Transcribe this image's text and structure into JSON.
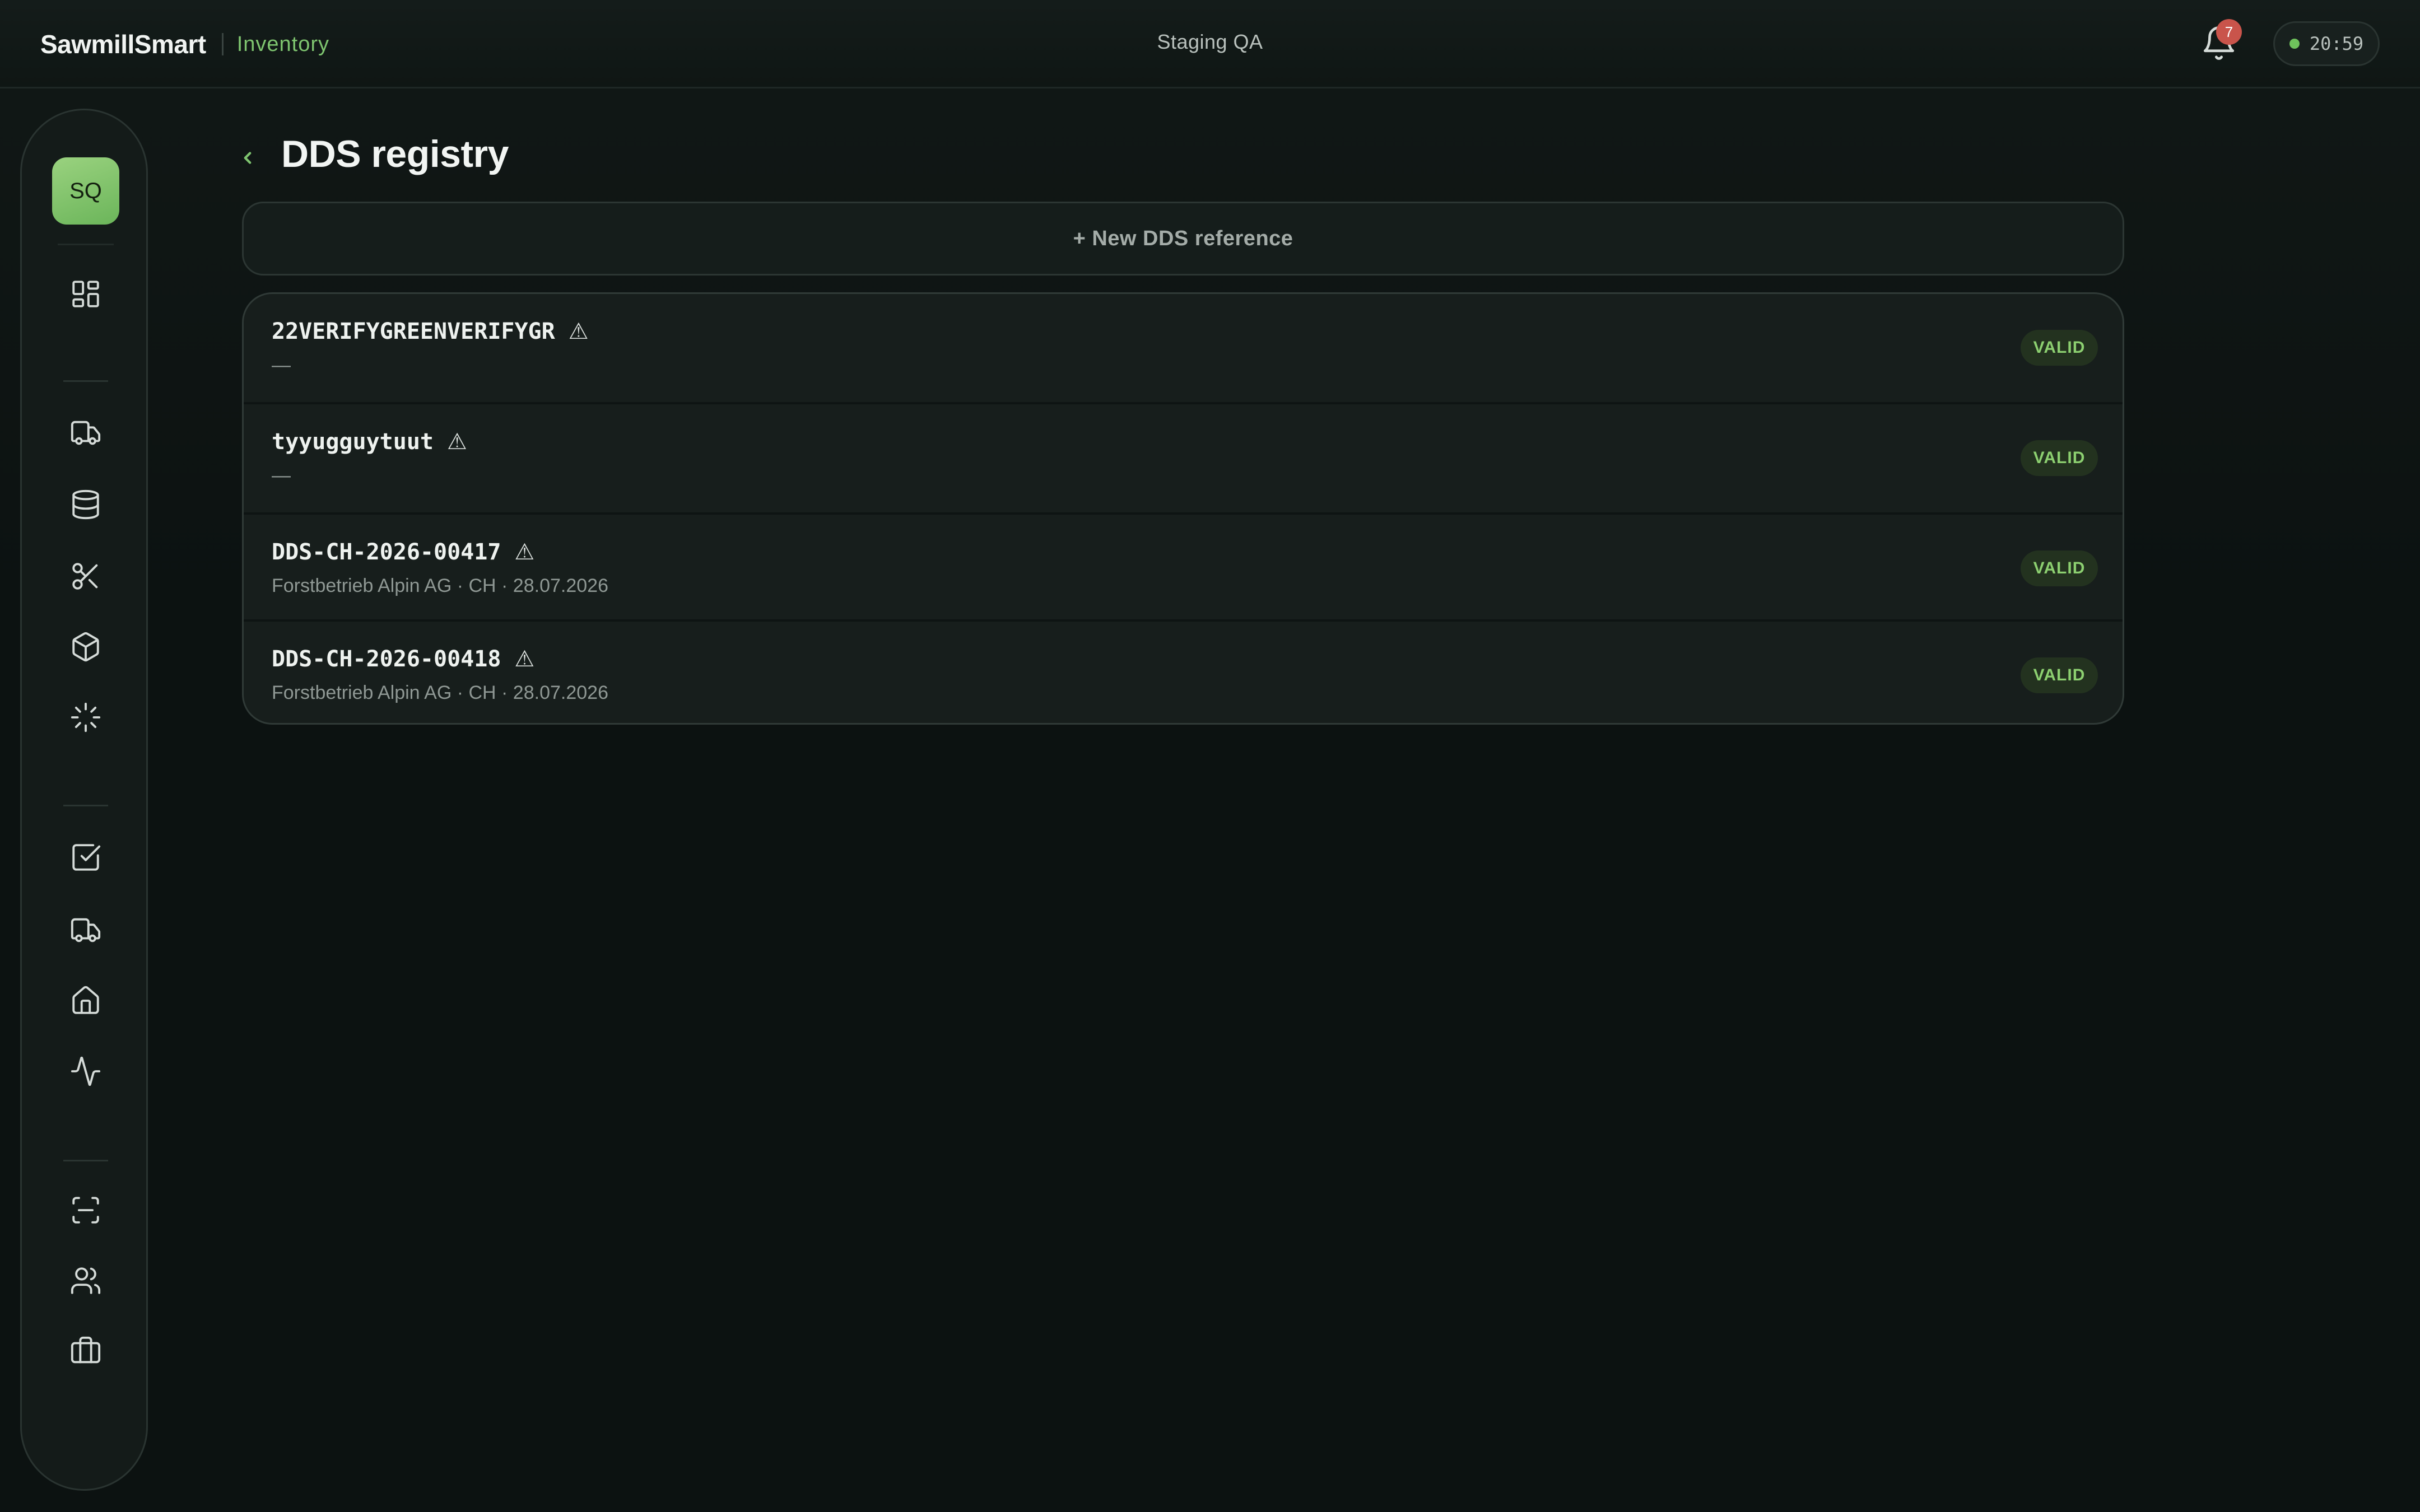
{
  "header": {
    "brand": "SawmillSmart",
    "module": "Inventory",
    "environment": "Staging QA",
    "notifications_count": "7",
    "clock": "20:59",
    "status_color": "#6fc25c"
  },
  "sidebar": {
    "avatar_initials": "SQ",
    "icons": [
      "dashboard-icon",
      "truck-icon",
      "database-icon",
      "scissors-icon",
      "box-icon",
      "loader-icon",
      "checkbox-icon",
      "delivery-truck-icon",
      "home-icon",
      "activity-icon",
      "scan-icon",
      "users-icon",
      "briefcase-icon"
    ]
  },
  "page": {
    "title": "DDS registry",
    "new_button": "+ New DDS reference"
  },
  "registry": [
    {
      "code": "22VERIFYGREENVERIFYGR",
      "warning": "⚠",
      "subtitle": "—",
      "status": "VALID"
    },
    {
      "code": "tyyugguytuut",
      "warning": "⚠",
      "subtitle": "—",
      "status": "VALID"
    },
    {
      "code": "DDS-CH-2026-00417",
      "warning": "⚠",
      "subtitle": "Forstbetrieb Alpin AG · CH · 28.07.2026",
      "status": "VALID"
    },
    {
      "code": "DDS-CH-2026-00418",
      "warning": "⚠",
      "subtitle": "Forstbetrieb Alpin AG · CH · 28.07.2026",
      "status": "VALID"
    }
  ],
  "colors": {
    "accent": "#7ec46f",
    "badge_bg": "#23321f",
    "notification_badge": "#c9544b"
  }
}
